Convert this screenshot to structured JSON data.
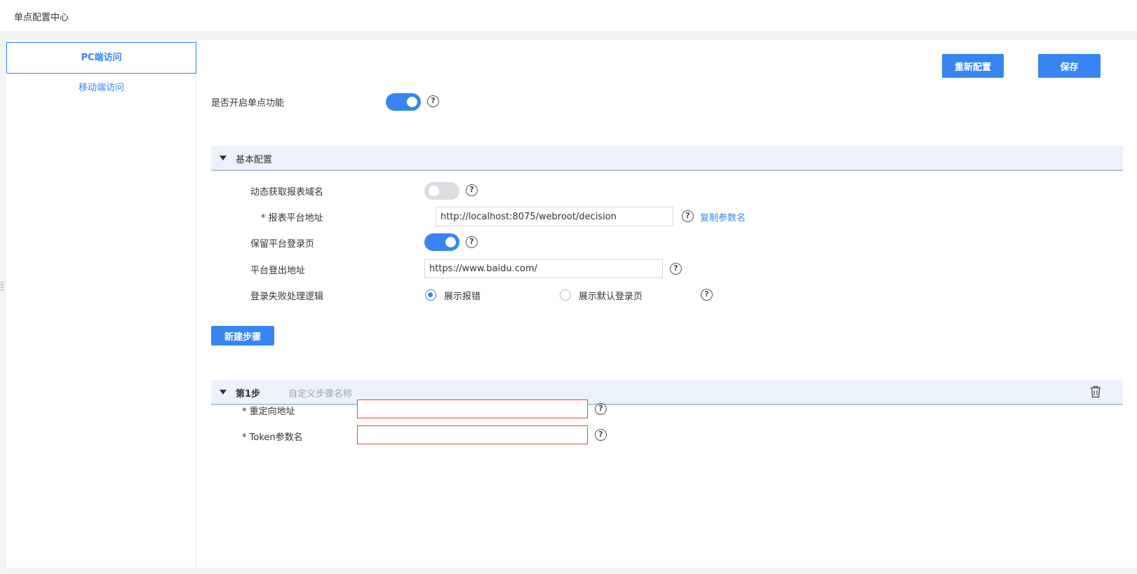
{
  "header": {
    "title": "单点配置中心"
  },
  "sidebar": {
    "items": [
      {
        "label": "PC端访问"
      },
      {
        "label": "移动端访问"
      }
    ]
  },
  "toolbar": {
    "reconfigure_label": "重新配置",
    "save_label": "保存"
  },
  "sso": {
    "label": "是否开启单点功能",
    "enabled": true
  },
  "basic": {
    "title": "基本配置",
    "dynamic_domain": {
      "label": "动态获取报表域名",
      "enabled": false
    },
    "platform_url": {
      "label": "* 报表平台地址",
      "value": "http://localhost:8075/webroot/decision",
      "copy_label": "复制参数名"
    },
    "keep_login": {
      "label": "保留平台登录页",
      "enabled": true
    },
    "logout_url": {
      "label": "平台登出地址",
      "value": "https://www.baidu.com/"
    },
    "fail_logic": {
      "label": "登录失败处理逻辑",
      "option1": "展示报错",
      "option2": "展示默认登录页",
      "selected": "展示报错"
    }
  },
  "new_step_label": "新建步骤",
  "step": {
    "title": "第1步",
    "name_placeholder": "自定义步骤名称",
    "redirect": {
      "label": "* 重定向地址",
      "value": ""
    },
    "token": {
      "label": "* Token参数名",
      "value": ""
    }
  },
  "help_mark": "?",
  "colors": {
    "accent": "#3685f2",
    "error": "#e8453c",
    "section_bg": "#ebf2fc"
  }
}
